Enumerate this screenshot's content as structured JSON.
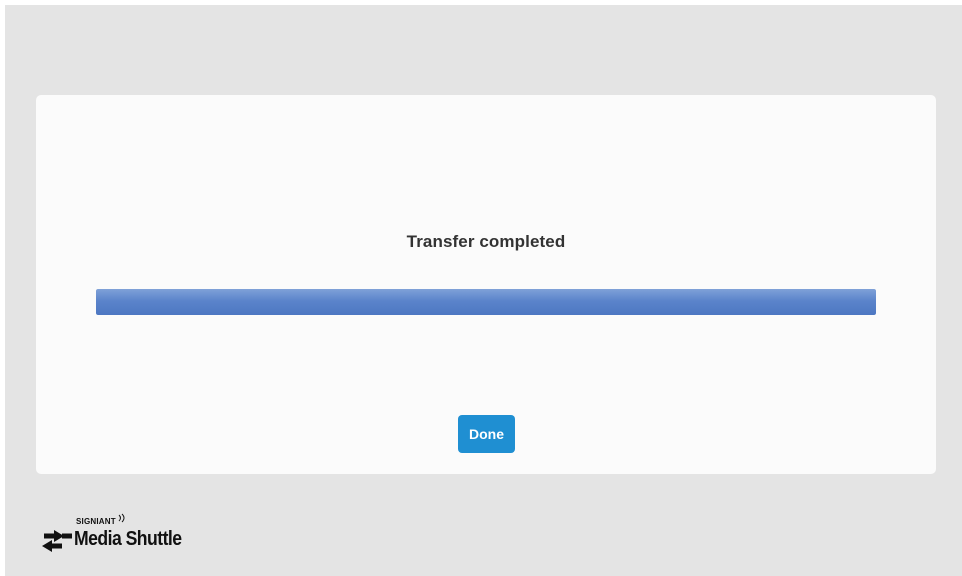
{
  "dialog": {
    "status_text": "Transfer completed",
    "progress_percent": 100,
    "done_label": "Done"
  },
  "branding": {
    "company": "SIGNIANT",
    "product": "Media Shuttle"
  },
  "colors": {
    "background": "#e4e4e4",
    "card": "#fbfbfb",
    "progress_fill": "#5b84cb",
    "button": "#1f8fd2",
    "text": "#333333"
  },
  "icons": {
    "logo": "transfer-arrows-icon"
  }
}
